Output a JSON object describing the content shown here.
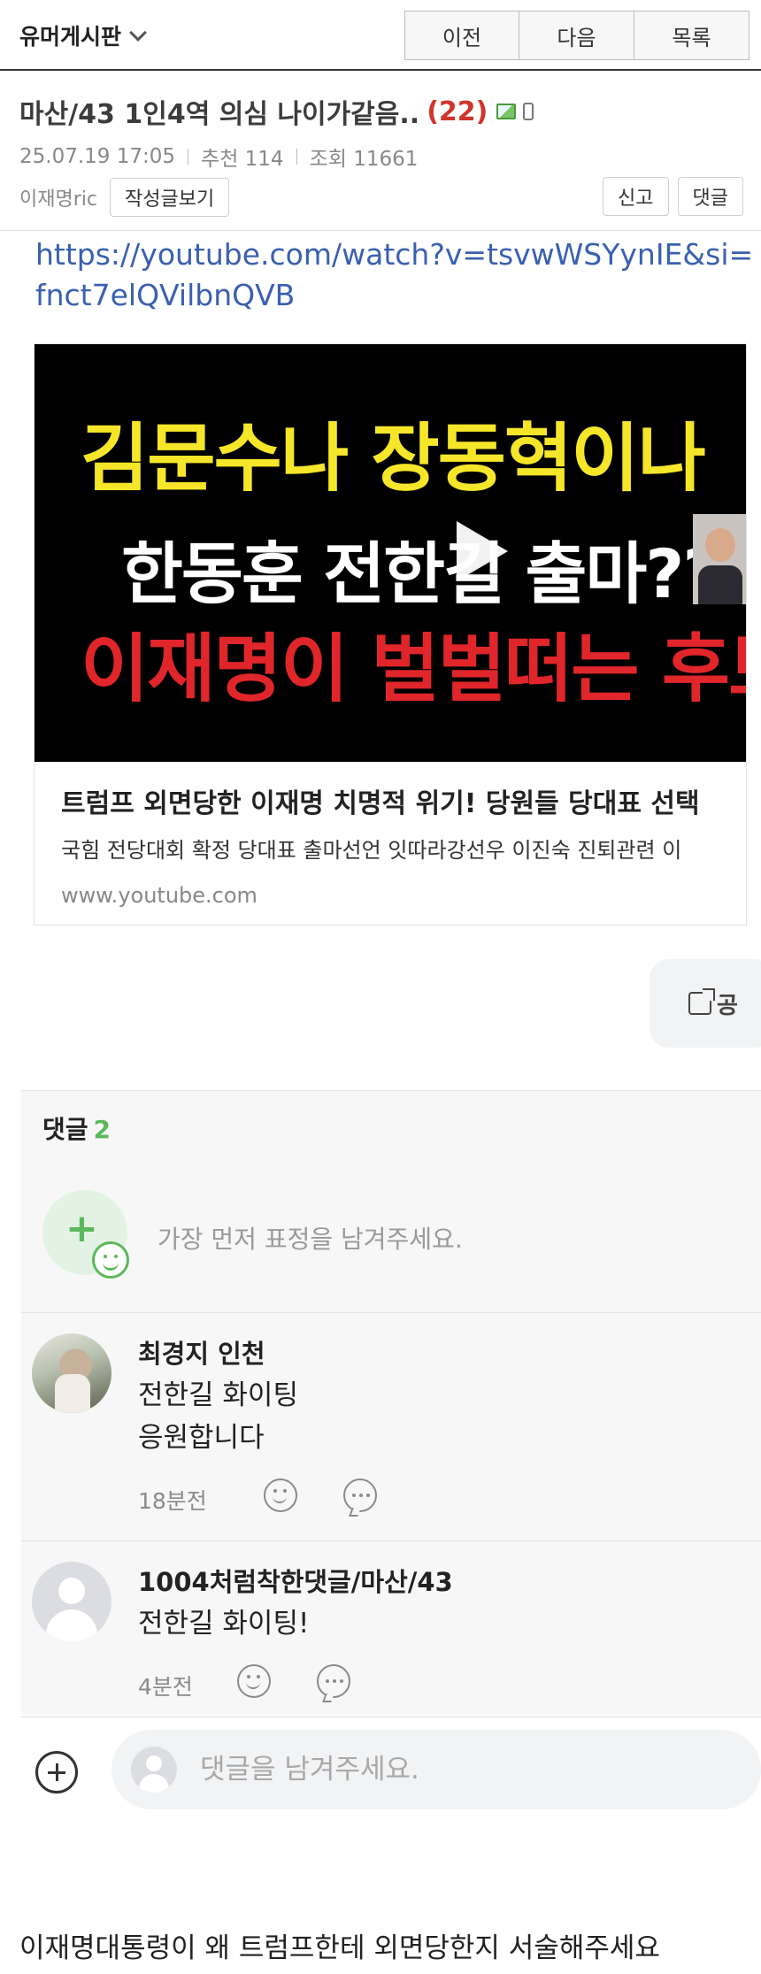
{
  "topbar": {
    "board_title": "유머게시판",
    "prev_label": "이전",
    "next_label": "다음",
    "list_label": "목록"
  },
  "post": {
    "title": "마산/43 1인4역 의심 나이가같음..",
    "comment_count": "(22)",
    "date": "25.07.19",
    "time": "17:05",
    "recommend": "추천 114",
    "views": "조회 11661",
    "author": "이재명ric",
    "view_posts_label": "작성글보기",
    "report_label": "신고",
    "reply_label": "댓글"
  },
  "content": {
    "link": "https://youtube.com/watch?v=tsvwWSYynIE&si=fnct7elQVilbnQVB",
    "video": {
      "thumb_line1": "김문수나 장동혁이나",
      "thumb_line2": "한동훈 전한길 출마??",
      "thumb_line3": "이재명이 벌벌떠는 후보",
      "title": "트럼프 외면당한 이재명 치명적 위기! 당원들 당대표 선택",
      "description": "국힘 전당대회 확정 당대표 출마선언 잇따라강선우 이진숙 진퇴관련 이",
      "url": "www.youtube.com"
    },
    "share_label": "공"
  },
  "comments": {
    "header": "댓글",
    "count": "2",
    "emoji_prompt": "가장 먼저 표정을 남겨주세요.",
    "items": [
      {
        "name": "최경지 인천",
        "line1": "전한길  화이팅",
        "line2": "응원합니다",
        "time": "18분전"
      },
      {
        "name": "1004처럼착한댓글/마산/43",
        "line1": "전한길 화이팅!",
        "time": "4분전"
      }
    ],
    "input_placeholder": "댓글을 남겨주세요."
  },
  "footer_text": "이재명대통령이 왜 트럼프한테 외면당한지 서술해주세요",
  "colors": {
    "accent_red": "#d0342c",
    "accent_green": "#5cb85c",
    "link_blue": "#3a60b0"
  }
}
